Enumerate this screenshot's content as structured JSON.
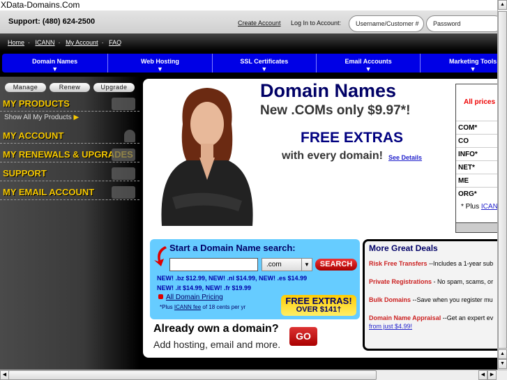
{
  "window": {
    "title": "XData-Domains.Com"
  },
  "header": {
    "support": "Support: (480) 624-2500",
    "create_account": "Create Account",
    "login_label": "Log In to Account:",
    "username_placeholder": "Username/Customer #",
    "password_placeholder": "Password"
  },
  "breadcrumb": {
    "items": [
      "Home",
      "ICANN",
      "My Account",
      "FAQ"
    ]
  },
  "nav": {
    "items": [
      "Domain Names",
      "Web Hosting",
      "SSL Certificates",
      "Email Accounts",
      "Marketing Tools"
    ]
  },
  "sidebar": {
    "buttons": [
      "Manage",
      "Renew",
      "Upgrade"
    ],
    "sections": [
      "MY PRODUCTS",
      "MY ACCOUNT",
      "MY RENEWALS & UPGRADES",
      "SUPPORT",
      "MY EMAIL ACCOUNT"
    ],
    "show_all": "Show All My Products"
  },
  "hero": {
    "title": "Domain Names",
    "subtitle": "New .COMs only $9.97*!",
    "free_extras": "FREE EXTRAS",
    "with_every": "with every domain!",
    "see_details": "See Details"
  },
  "prices": {
    "header": "All prices",
    "tlds": [
      "COM*",
      "CO",
      "INFO*",
      "NET*",
      "ME",
      "ORG*"
    ],
    "note": "* Plus",
    "note_link": "ICANN"
  },
  "search": {
    "title": "Start a Domain Name search:",
    "input_value": "",
    "tld_selected": ".com",
    "button": "SEARCH",
    "new_line1": "NEW! .bz $12.99, NEW! .nl $14.99, NEW! .es $14.99",
    "new_line2": "NEW! .it $14.99, NEW! .fr $19.99",
    "all_pricing": "All Domain Pricing",
    "icann_prefix": "*Plus",
    "icann_link": "ICANN fee",
    "icann_suffix": "of 18 cents per yr",
    "free_extras": "FREE EXTRAS!",
    "over": "OVER $141†"
  },
  "own": {
    "title": "Already own a domain?",
    "subtitle": "Add hosting, email and more.",
    "go": "GO"
  },
  "deals": {
    "title": "More Great Deals",
    "items": [
      {
        "name": "Risk Free Transfers",
        "desc": "--Includes a 1-year sub"
      },
      {
        "name": "Private Registrations",
        "desc": "- No spam, scams, or"
      },
      {
        "name": "Bulk Domains",
        "desc": "--Save when you register mu"
      },
      {
        "name": "Domain Name Appraisal",
        "desc": "--Get an expert ev"
      }
    ],
    "link": "from just $4.99!"
  }
}
